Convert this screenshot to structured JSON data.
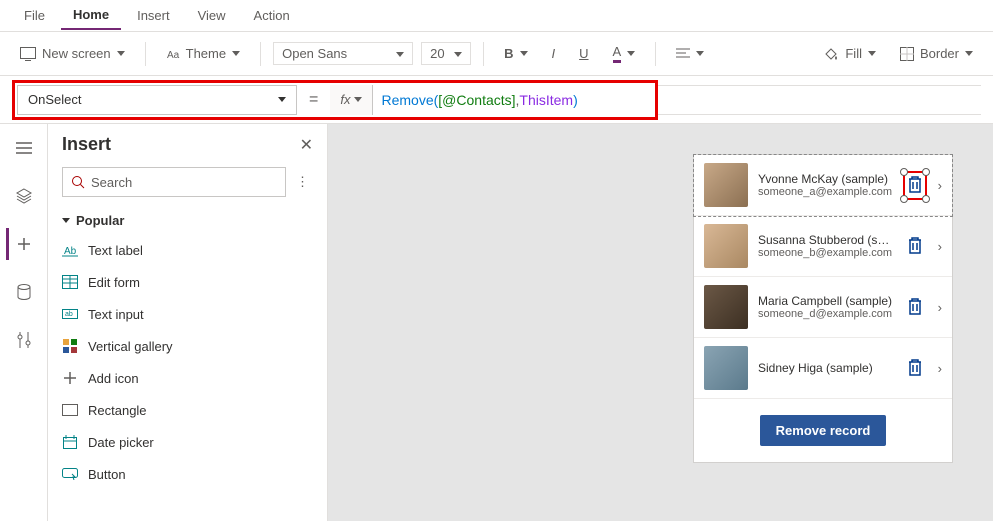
{
  "menu": {
    "file": "File",
    "home": "Home",
    "insert": "Insert",
    "view": "View",
    "action": "Action"
  },
  "ribbon": {
    "new_screen": "New screen",
    "theme": "Theme",
    "font_name": "Open Sans",
    "font_size": "20",
    "bold": "B",
    "italic": "I",
    "underline": "U",
    "color": "A",
    "fill": "Fill",
    "border": "Border"
  },
  "formula": {
    "property": "OnSelect",
    "fx": "fx",
    "fn": "Remove",
    "open": "(",
    "ds": " [@Contacts]",
    "comma": ", ",
    "kw": "ThisItem",
    "close": " )"
  },
  "panel": {
    "title": "Insert",
    "search_placeholder": "Search",
    "group": "Popular",
    "items": [
      "Text label",
      "Edit form",
      "Text input",
      "Vertical gallery",
      "Add icon",
      "Rectangle",
      "Date picker",
      "Button"
    ]
  },
  "gallery": {
    "items": [
      {
        "name": "Yvonne McKay (sample)",
        "email": "someone_a@example.com"
      },
      {
        "name": "Susanna Stubberod (sample)",
        "email": "someone_b@example.com"
      },
      {
        "name": "Maria Campbell (sample)",
        "email": "someone_d@example.com"
      },
      {
        "name": "Sidney Higa (sample)",
        "email": ""
      }
    ],
    "remove_label": "Remove record"
  }
}
